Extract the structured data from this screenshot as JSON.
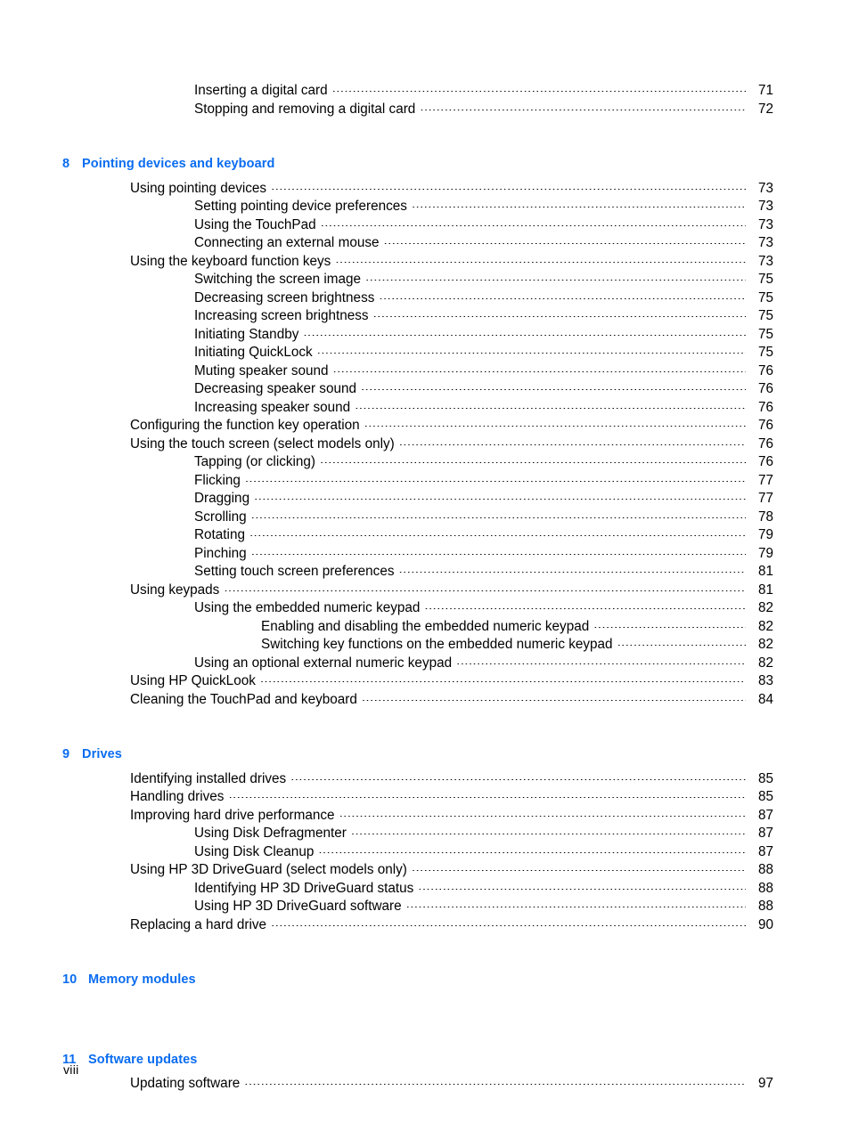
{
  "document": {
    "type": "table-of-contents",
    "folio": "viii",
    "accent_color": "#0a6cf0",
    "text_color": "#000000",
    "background_color": "#ffffff"
  },
  "toc": {
    "blocks": [
      {
        "kind": "entries",
        "entries": [
          {
            "level": 2,
            "title": "Inserting a digital card",
            "page": "71"
          },
          {
            "level": 2,
            "title": "Stopping and removing a digital card",
            "page": "72"
          }
        ]
      },
      {
        "kind": "chapter",
        "number": "8",
        "title": "Pointing devices and keyboard",
        "entries": [
          {
            "level": 1,
            "title": "Using pointing devices",
            "page": "73"
          },
          {
            "level": 2,
            "title": "Setting pointing device preferences",
            "page": "73"
          },
          {
            "level": 2,
            "title": "Using the TouchPad",
            "page": "73"
          },
          {
            "level": 2,
            "title": "Connecting an external mouse",
            "page": "73"
          },
          {
            "level": 1,
            "title": "Using the keyboard function keys",
            "page": "73"
          },
          {
            "level": 2,
            "title": "Switching the screen image",
            "page": "75"
          },
          {
            "level": 2,
            "title": "Decreasing screen brightness",
            "page": "75"
          },
          {
            "level": 2,
            "title": "Increasing screen brightness",
            "page": "75"
          },
          {
            "level": 2,
            "title": "Initiating Standby",
            "page": "75"
          },
          {
            "level": 2,
            "title": "Initiating QuickLock",
            "page": "75"
          },
          {
            "level": 2,
            "title": "Muting speaker sound",
            "page": "76"
          },
          {
            "level": 2,
            "title": "Decreasing speaker sound",
            "page": "76"
          },
          {
            "level": 2,
            "title": "Increasing speaker sound",
            "page": "76"
          },
          {
            "level": 1,
            "title": "Configuring the function key operation",
            "page": "76"
          },
          {
            "level": 1,
            "title": "Using the touch screen (select models only)",
            "page": "76"
          },
          {
            "level": 2,
            "title": "Tapping (or clicking)",
            "page": "76"
          },
          {
            "level": 2,
            "title": "Flicking",
            "page": "77"
          },
          {
            "level": 2,
            "title": "Dragging ",
            "page": "77"
          },
          {
            "level": 2,
            "title": "Scrolling",
            "page": "78"
          },
          {
            "level": 2,
            "title": "Rotating ",
            "page": "79"
          },
          {
            "level": 2,
            "title": "Pinching",
            "page": "79"
          },
          {
            "level": 2,
            "title": "Setting touch screen preferences",
            "page": "81"
          },
          {
            "level": 1,
            "title": "Using keypads",
            "page": "81"
          },
          {
            "level": 2,
            "title": "Using the embedded numeric keypad",
            "page": "82"
          },
          {
            "level": 3,
            "title": "Enabling and disabling the embedded numeric keypad",
            "page": "82"
          },
          {
            "level": 3,
            "title": "Switching key functions on the embedded numeric keypad",
            "page": "82"
          },
          {
            "level": 2,
            "title": "Using an optional external numeric keypad",
            "page": "82"
          },
          {
            "level": 1,
            "title": "Using HP QuickLook",
            "page": "83"
          },
          {
            "level": 1,
            "title": "Cleaning the TouchPad and keyboard",
            "page": "84"
          }
        ]
      },
      {
        "kind": "chapter",
        "number": "9",
        "title": "Drives",
        "entries": [
          {
            "level": 1,
            "title": "Identifying installed drives",
            "page": "85"
          },
          {
            "level": 1,
            "title": "Handling drives",
            "page": "85"
          },
          {
            "level": 1,
            "title": "Improving hard drive performance",
            "page": "87"
          },
          {
            "level": 2,
            "title": "Using Disk Defragmenter",
            "page": "87"
          },
          {
            "level": 2,
            "title": "Using Disk Cleanup",
            "page": "87"
          },
          {
            "level": 1,
            "title": "Using HP 3D DriveGuard (select models only) ",
            "page": "88"
          },
          {
            "level": 2,
            "title": "Identifying HP 3D DriveGuard status",
            "page": "88"
          },
          {
            "level": 2,
            "title": "Using HP 3D DriveGuard software",
            "page": "88"
          },
          {
            "level": 1,
            "title": "Replacing a hard drive",
            "page": "90"
          }
        ]
      },
      {
        "kind": "chapter",
        "number": "10",
        "title": "Memory modules",
        "entries": []
      },
      {
        "kind": "chapter",
        "number": "11",
        "title": "Software updates",
        "entries": [
          {
            "level": 1,
            "title": "Updating software",
            "page": "97"
          }
        ]
      }
    ]
  }
}
